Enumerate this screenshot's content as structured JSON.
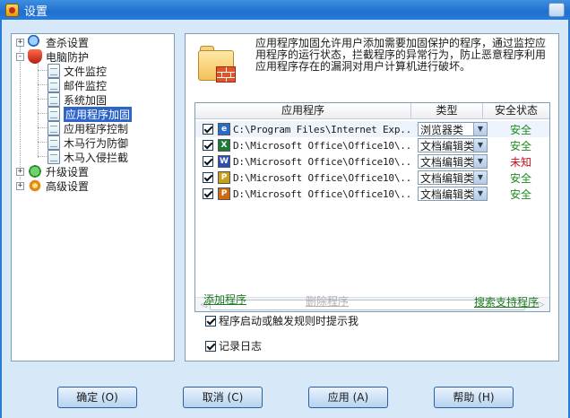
{
  "window": {
    "title": "设置"
  },
  "tree": [
    {
      "label": "查杀设置",
      "expander": "+",
      "icon": "search-shield-icon"
    },
    {
      "label": "电脑防护",
      "expander": "-",
      "icon": "shield-icon"
    },
    {
      "label": "文件监控",
      "icon": "page-icon"
    },
    {
      "label": "邮件监控",
      "icon": "page-icon"
    },
    {
      "label": "系统加固",
      "icon": "page-icon"
    },
    {
      "label": "应用程序加固",
      "icon": "page-icon",
      "selected": true
    },
    {
      "label": "应用程序控制",
      "icon": "page-icon"
    },
    {
      "label": "木马行为防御",
      "icon": "page-icon"
    },
    {
      "label": "木马入侵拦截",
      "icon": "page-icon"
    },
    {
      "label": "升级设置",
      "expander": "+",
      "icon": "upgrade-icon"
    },
    {
      "label": "高级设置",
      "expander": "+",
      "icon": "gear-icon"
    }
  ],
  "panel": {
    "description": "应用程序加固允许用户添加需要加固保护的程序，通过监控应用程序的运行状态，拦截程序的异常行为，防止恶意程序利用应用程序存在的漏洞对用户计算机进行破坏。",
    "table": {
      "headers": {
        "app": "应用程序",
        "type": "类型",
        "status": "安全状态"
      },
      "rows": [
        {
          "path": "C:\\Program Files\\Internet Exp...",
          "type": "浏览器类",
          "status": "安全",
          "status_color": "#1f8a1f",
          "icon": "internet-explorer-icon",
          "icon_color": "#2a6ac8",
          "icon_letter": "e"
        },
        {
          "path": "D:\\Microsoft Office\\Office10\\...",
          "type": "文档编辑类",
          "status": "安全",
          "status_color": "#1f8a1f",
          "icon": "excel-icon",
          "icon_color": "#1f7a3a",
          "icon_letter": "X"
        },
        {
          "path": "D:\\Microsoft Office\\Office10\\...",
          "type": "文档编辑类",
          "status": "未知",
          "status_color": "#c8101a",
          "icon": "word-icon",
          "icon_color": "#2a4fb0",
          "icon_letter": "W"
        },
        {
          "path": "D:\\Microsoft Office\\Office10\\...",
          "type": "文档编辑类",
          "status": "安全",
          "status_color": "#1f8a1f",
          "icon": "publisher-icon",
          "icon_color": "#c8a020",
          "icon_letter": "P"
        },
        {
          "path": "D:\\Microsoft Office\\Office10\\...",
          "type": "文档编辑类",
          "status": "安全",
          "status_color": "#1f8a1f",
          "icon": "powerpoint-icon",
          "icon_color": "#d06a10",
          "icon_letter": "P"
        }
      ]
    },
    "add_program": "添加程序",
    "remove_program": "删除程序",
    "search_supported": "搜索支持程序",
    "option_prompt": "程序启动或触发规则时提示我",
    "option_log": "记录日志"
  },
  "buttons": {
    "ok": "确定 (O)",
    "cancel": "取消 (C)",
    "apply": "应用 (A)",
    "help": "帮助 (H)"
  }
}
